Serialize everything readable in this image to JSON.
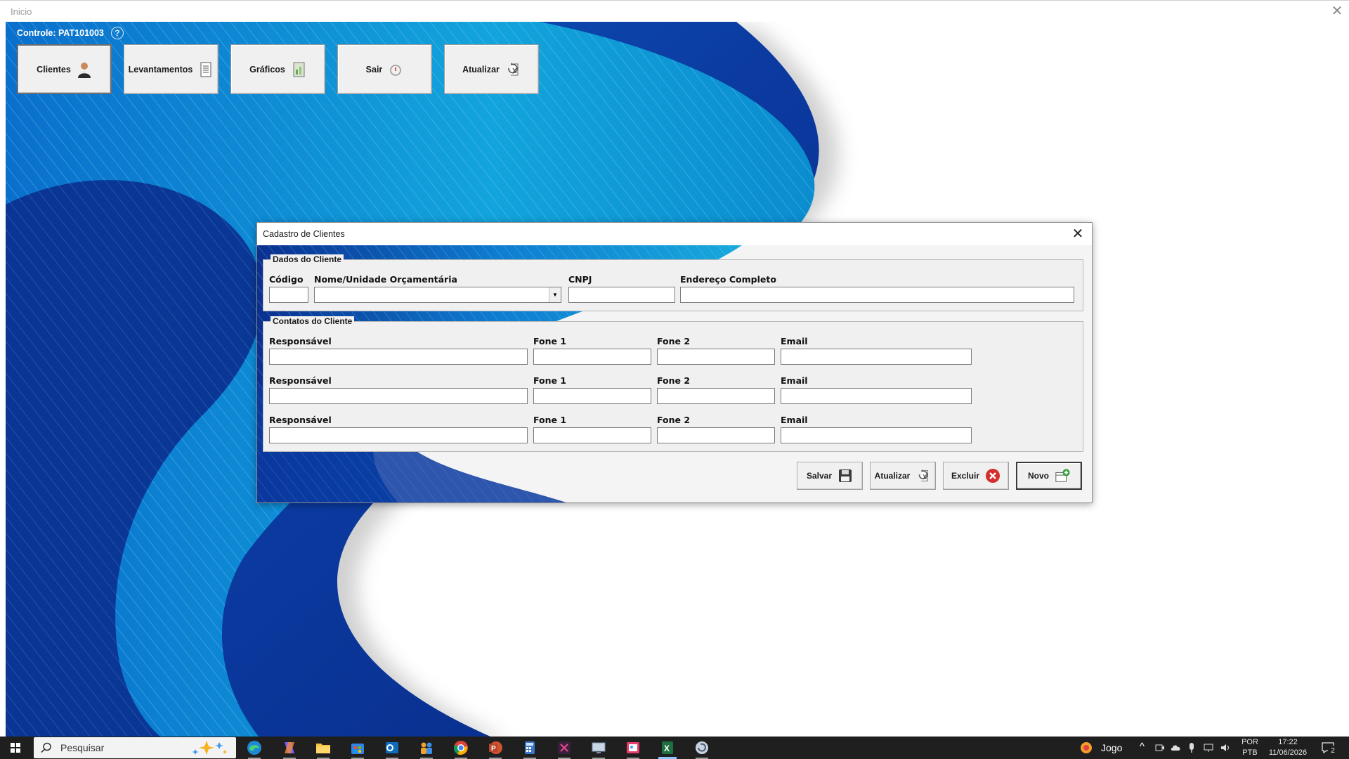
{
  "app_window": {
    "title": "Inicio",
    "close_glyph": "✕"
  },
  "header": {
    "controle_label": "Controle: PAT101003",
    "help_glyph": "?"
  },
  "nav": {
    "buttons": [
      {
        "label": "Clientes",
        "icon": "user-icon"
      },
      {
        "label": "Levantamentos",
        "icon": "document-icon"
      },
      {
        "label": "Gráficos",
        "icon": "chart-icon"
      },
      {
        "label": "Sair",
        "icon": "power-icon"
      },
      {
        "label": "Atualizar",
        "icon": "refresh-icon"
      }
    ]
  },
  "dialog": {
    "title": "Cadastro de Clientes",
    "close_glyph": "✕",
    "dados": {
      "title": "Dados do Cliente",
      "codigo": {
        "label": "Código",
        "value": ""
      },
      "nome": {
        "label": "Nome/Unidade Orçamentária",
        "value": ""
      },
      "cnpj": {
        "label": "CNPJ",
        "value": ""
      },
      "endereco": {
        "label": "Endereço Completo",
        "value": ""
      }
    },
    "contatos": {
      "title": "Contatos do Cliente",
      "rows": [
        {
          "responsavel_label": "Responsável",
          "fone1_label": "Fone 1",
          "fone2_label": "Fone 2",
          "email_label": "Email",
          "responsavel": "",
          "fone1": "",
          "fone2": "",
          "email": ""
        },
        {
          "responsavel_label": "Responsável",
          "fone1_label": "Fone 1",
          "fone2_label": "Fone 2",
          "email_label": "Email",
          "responsavel": "",
          "fone1": "",
          "fone2": "",
          "email": ""
        },
        {
          "responsavel_label": "Responsável",
          "fone1_label": "Fone 1",
          "fone2_label": "Fone 2",
          "email_label": "Email",
          "responsavel": "",
          "fone1": "",
          "fone2": "",
          "email": ""
        }
      ]
    },
    "actions": {
      "salvar": "Salvar",
      "atualizar": "Atualizar",
      "excluir": "Excluir",
      "novo": "Novo"
    }
  },
  "taskbar": {
    "search_placeholder": "Pesquisar",
    "weather_label": "Jogo",
    "lang_top": "POR",
    "lang_bottom": "PTB",
    "time": "17:22",
    "date": "11/06/2026",
    "notification_count": "2"
  },
  "colors": {
    "wave_dark": "#0b2e8c",
    "wave_mid": "#0a69c8",
    "wave_light": "#14a6d9",
    "accent_cyan": "#2cc0e0",
    "taskbar": "#1f1f1f"
  }
}
